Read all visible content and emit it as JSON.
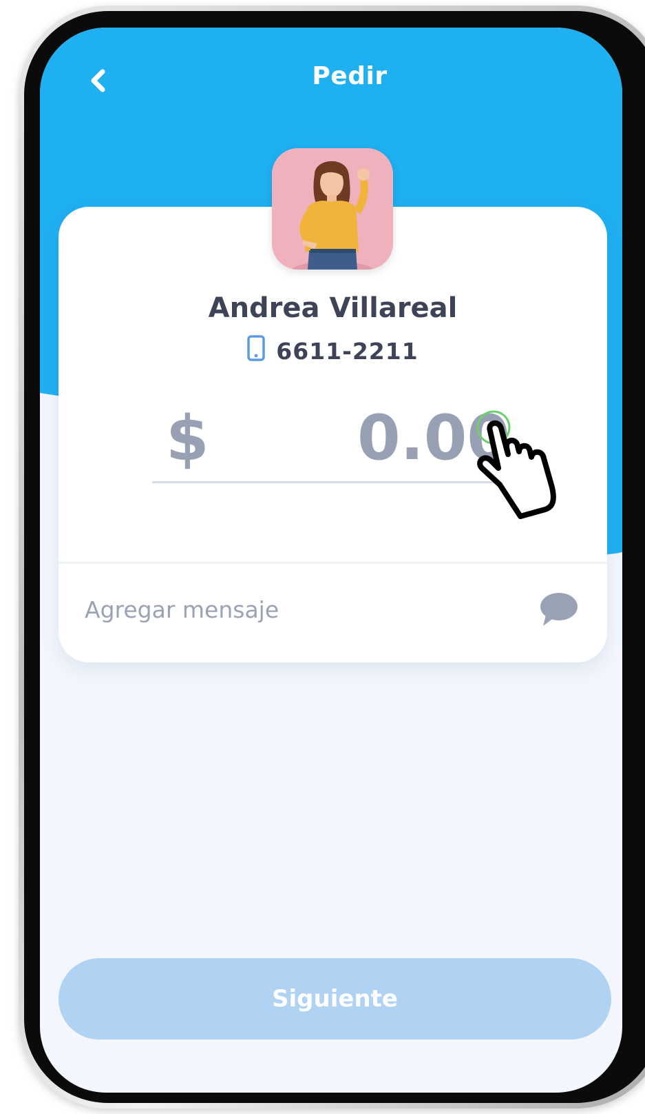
{
  "header": {
    "title": "Pedir",
    "back_icon": "chevron-left-icon"
  },
  "recipient": {
    "name": "Andrea Villareal",
    "phone": "6611-2211",
    "phone_icon": "mobile-phone-icon",
    "avatar_icon": "avatar-photo"
  },
  "amount": {
    "currency_symbol": "$",
    "value": "",
    "placeholder": "0.00"
  },
  "message": {
    "placeholder": "Agregar mensaje",
    "icon": "chat-bubble-icon"
  },
  "footer": {
    "next_label": "Siguiente"
  },
  "colors": {
    "primary_blue": "#1fb0f2",
    "button_disabled": "#b0d2f3",
    "text_dark": "#3d4458",
    "text_muted": "#98a1b3",
    "screen_bg": "#f3f7fd"
  }
}
